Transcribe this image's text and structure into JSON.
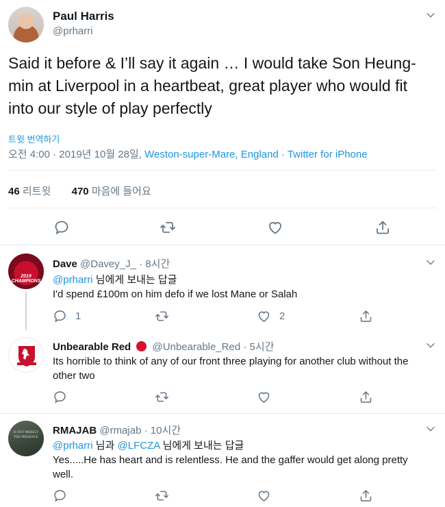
{
  "main_tweet": {
    "author_name": "Paul Harris",
    "author_handle": "@prharri",
    "text": "Said it before & I’ll say it again … I would take Son Heung-min at Liverpool in a heartbeat, great player who would fit into our style of play perfectly",
    "translate_label": "트윗 번역하기",
    "time_date": "오전 4:00 · 2019년 10월 28일",
    "location": "Weston-super-Mare, England",
    "source": "Twitter for iPhone",
    "retweet_count": "46",
    "retweet_label": "리트윗",
    "like_count": "470",
    "like_label": "마음에 들어요"
  },
  "replies": [
    {
      "name": "Dave",
      "handle": "@Davey_J_",
      "time": "8시간",
      "replying_to_handle": "@prharri",
      "replying_suffix": "님에게 보내는 답글",
      "text": "I'd spend £100m on him defo if we lost Mane or Salah",
      "reply_count": "1",
      "like_count": "2",
      "avatar_text": "2019 CHAMPIONS"
    },
    {
      "name": "Unbearable Red",
      "handle": "@Unbearable_Red",
      "time": "5시간",
      "text": "Its horrible to think of any of our front three playing for another club without the other two"
    },
    {
      "name": "RMAJAB",
      "handle": "@rmajab",
      "time": "10시간",
      "replying_to_handle_1": "@prharri",
      "replying_conj": "님과",
      "replying_to_handle_2": "@LFCZA",
      "replying_suffix": "님에게 보내는 답글",
      "text": "Yes.....He has heart and is relentless. He and the gaffer would get along pretty well.",
      "avatar_text": "IS NOT MERELY THE PRESENCE"
    }
  ],
  "icons": [
    "chevron-down-icon",
    "reply-icon",
    "retweet-icon",
    "like-icon",
    "share-icon"
  ],
  "colors": {
    "link": "#1b95e0",
    "muted": "#657786",
    "text": "#14171a",
    "divider": "#e6ecf0",
    "red_dot": "#d8102f"
  }
}
